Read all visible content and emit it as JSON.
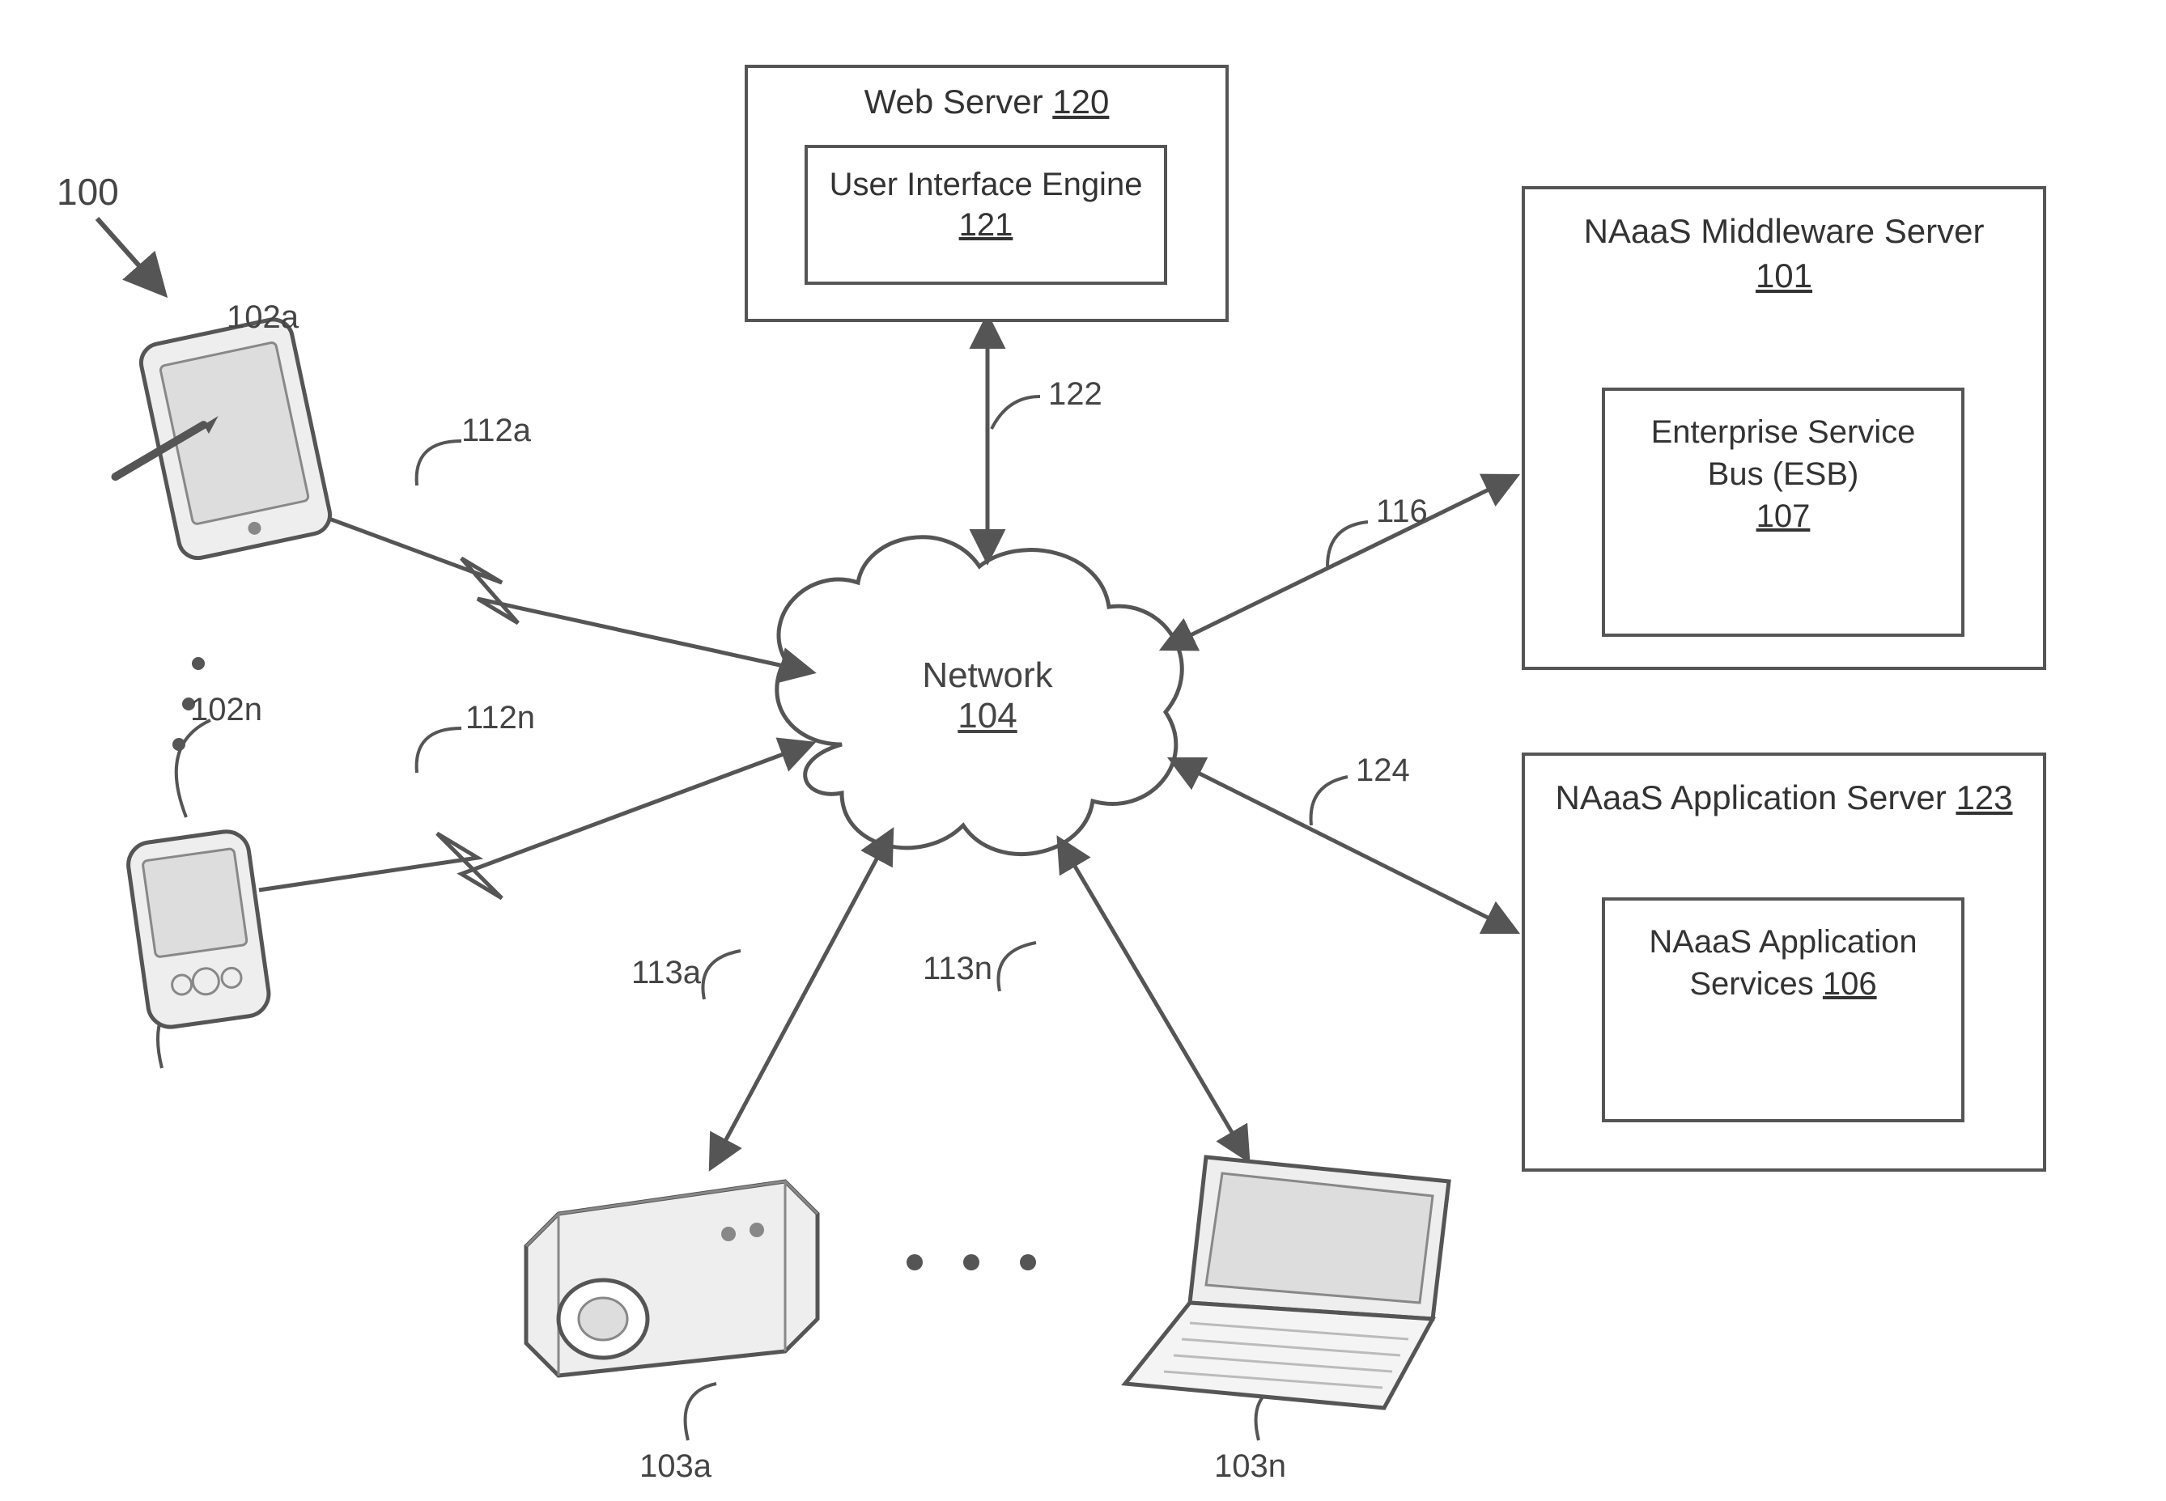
{
  "figure_ref": "100",
  "network": {
    "title": "Network",
    "ref": "104"
  },
  "web_server": {
    "title": "Web Server",
    "ref": "120",
    "inner": {
      "title": "User Interface Engine",
      "ref": "121"
    }
  },
  "middleware": {
    "title": "NAaaS Middleware Server",
    "ref": "101",
    "inner": {
      "title": "Enterprise Service Bus (ESB)",
      "ref": "107"
    }
  },
  "app_server": {
    "title": "NAaaS Application Server",
    "ref": "123",
    "inner": {
      "title": "NAaaS Application Services",
      "ref": "106"
    }
  },
  "devices": {
    "tablet_ref": "102a",
    "pda_ref": "102n",
    "projector_ref": "103a",
    "laptop_ref": "103n"
  },
  "links": {
    "wireless_a": "112a",
    "wireless_n": "112n",
    "web": "122",
    "middleware": "116",
    "app": "124",
    "dev_a": "113a",
    "dev_n": "113n"
  }
}
